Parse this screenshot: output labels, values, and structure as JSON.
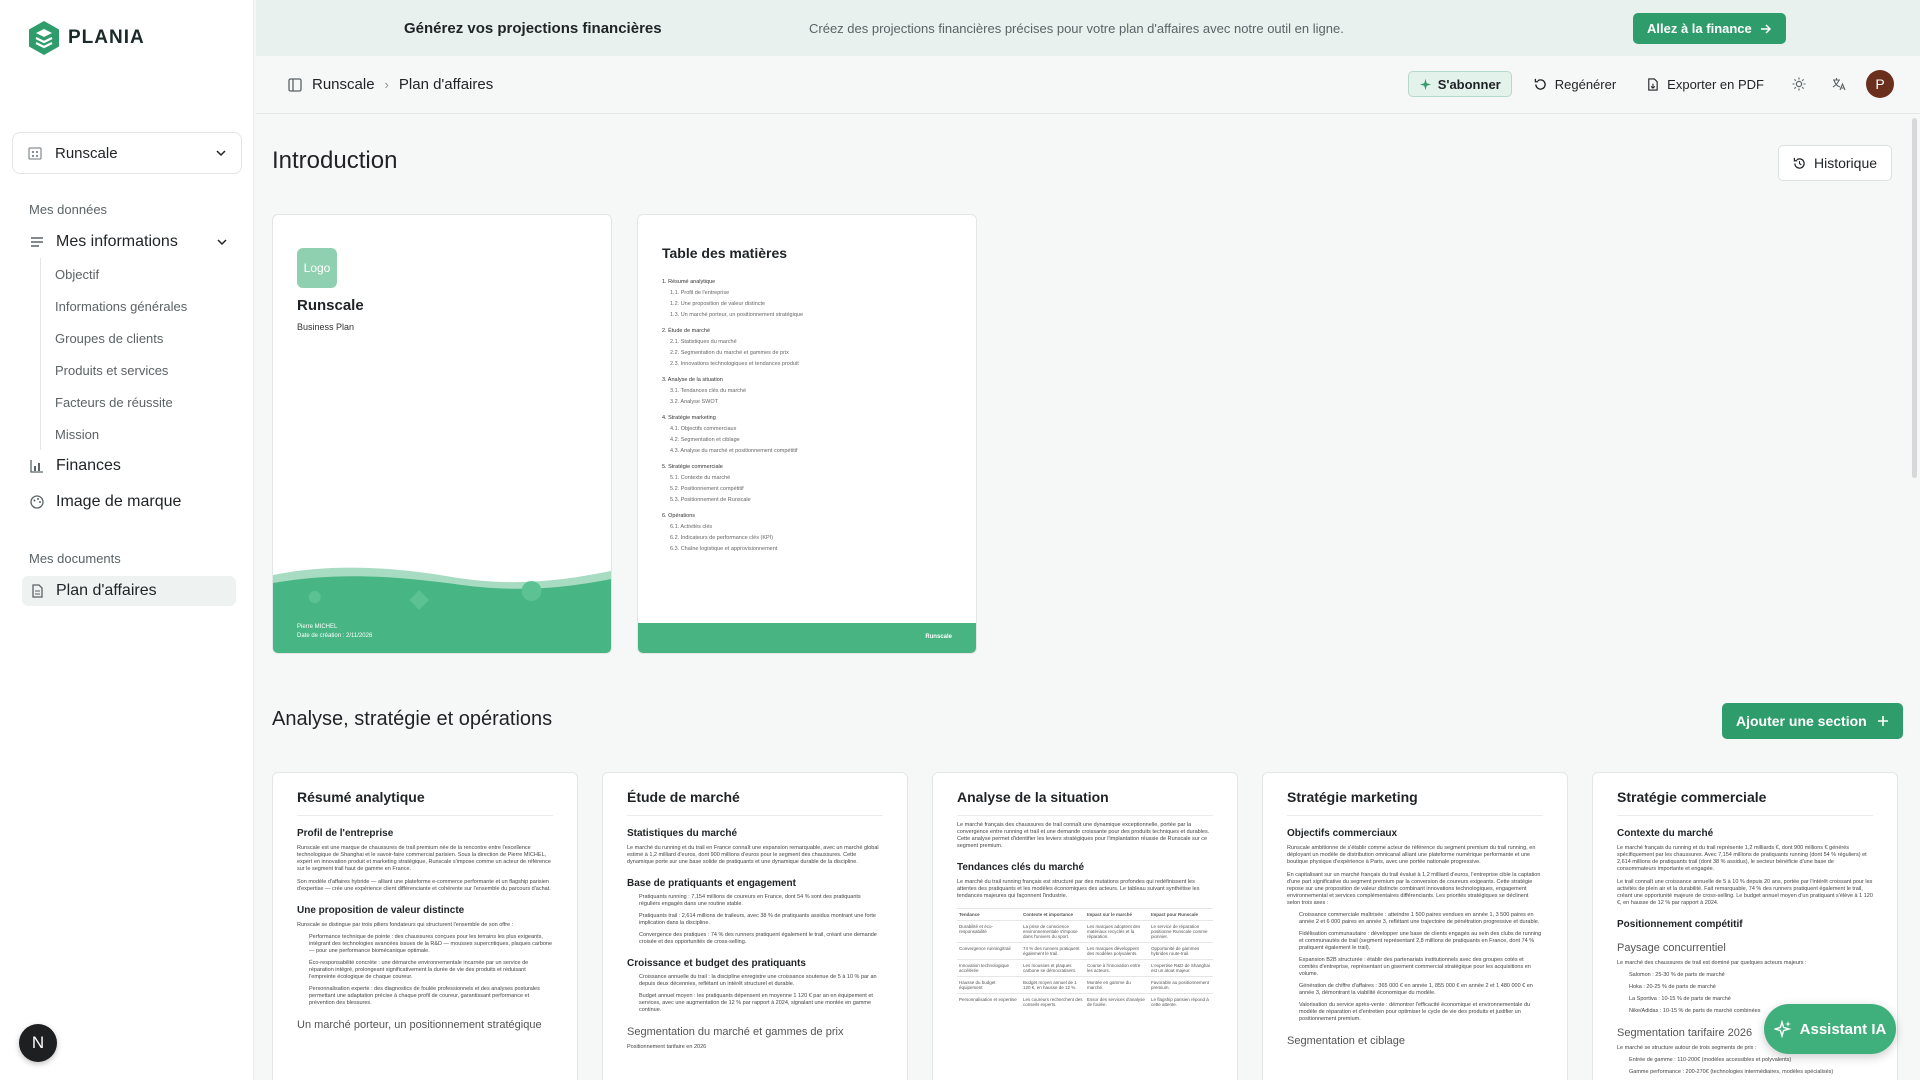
{
  "brand": {
    "name": "PLANIA",
    "accent": "#2f9c6c"
  },
  "banner": {
    "title": "Générez vos projections financières",
    "description": "Créez des projections financières précises pour votre plan d'affaires avec notre outil en ligne.",
    "cta": "Allez à la finance"
  },
  "sidebar": {
    "workspace": "Runscale",
    "section_data": "Mes données",
    "my_info": "Mes informations",
    "sub_items": [
      "Objectif",
      "Informations générales",
      "Groupes de clients",
      "Produits et services",
      "Facteurs de réussite",
      "Mission"
    ],
    "finances": "Finances",
    "brand_image": "Image de marque",
    "section_docs": "Mes documents",
    "business_plan": "Plan d'affaires",
    "bottom_avatar": "N"
  },
  "header": {
    "breadcrumb": [
      "Runscale",
      "Plan d'affaires"
    ],
    "subscribe": "S'abonner",
    "regenerate": "Regénérer",
    "export_pdf": "Exporter en PDF",
    "user_initial": "P"
  },
  "intro": {
    "title": "Introduction",
    "history": "Historique",
    "cover": {
      "logo": "Logo",
      "company": "Runscale",
      "subtitle": "Business Plan",
      "author": "Pierre MICHEL",
      "date": "Date de création : 2/11/2026"
    },
    "toc": {
      "title": "Table des matières",
      "footer": "Runscale",
      "sections": [
        {
          "title": "1. Résumé analytique",
          "items": [
            "1.1. Profil de l'entreprise",
            "1.2. Une proposition de valeur distincte",
            "1.3. Un marché porteur, un positionnement stratégique"
          ]
        },
        {
          "title": "2. Étude de marché",
          "items": [
            "2.1. Statistiques du marché",
            "2.2. Segmentation du marché et gammes de prix",
            "2.3. Innovations technologiques et tendances produit"
          ]
        },
        {
          "title": "3. Analyse de la situation",
          "items": [
            "3.1. Tendances clés du marché",
            "3.2. Analyse SWOT"
          ]
        },
        {
          "title": "4. Stratégie marketing",
          "items": [
            "4.1. Objectifs commerciaux",
            "4.2. Segmentation et ciblage",
            "4.3. Analyse du marché et positionnement compétitif"
          ]
        },
        {
          "title": "5. Stratégie commerciale",
          "items": [
            "5.1. Contexte du marché",
            "5.2. Positionnement compétitif",
            "5.3. Positionnement de Runscale"
          ]
        },
        {
          "title": "6. Opérations",
          "items": [
            "6.1. Activités clés",
            "6.2. Indicateurs de performance clés (KPI)",
            "6.3. Chaîne logistique et approvisionnement"
          ]
        }
      ]
    }
  },
  "analysis": {
    "title": "Analyse, stratégie et opérations",
    "add_section": "Ajouter une section",
    "cards": [
      {
        "title": "Résumé analytique",
        "blocks": [
          {
            "type": "sub",
            "text": "Profil de l'entreprise"
          },
          {
            "type": "text",
            "text": "Runscale est une marque de chaussures de trail premium née de la rencontre entre l'excellence technologique de Shanghai et le savoir-faire commercial parisien. Sous la direction de Pierre MICHEL, expert en innovation produit et marketing stratégique, Runscale s'impose comme un acteur de référence sur le segment trail haut de gamme en France."
          },
          {
            "type": "text",
            "text": "Son modèle d'affaires hybride — alliant une plateforme e-commerce performante et un flagship parisien d'expertise — crée une expérience client différenciante et cohérente sur l'ensemble du parcours d'achat."
          },
          {
            "type": "sub",
            "text": "Une proposition de valeur distincte"
          },
          {
            "type": "text",
            "text": "Runscale se distingue par trois piliers fondateurs qui structurent l'ensemble de son offre :"
          },
          {
            "type": "bullet",
            "text": "Performance technique de pointe : des chaussures conçues pour les terrains les plus exigeants, intégrant des technologies avancées issues de la R&D — mousses supercritiques, plaques carbone — pour une performance biomécanique optimale."
          },
          {
            "type": "bullet",
            "text": "Éco-responsabilité concrète : une démarche environnementale incarnée par un service de réparation intégré, prolongeant significativement la durée de vie des produits et réduisant l'empreinte écologique de chaque coureur."
          },
          {
            "type": "bullet",
            "text": "Personnalisation experte : des diagnostics de foulée professionnels et des analyses posturales permettant une adaptation précise à chaque profil de coureur, garantissant performance et prévention des blessures."
          },
          {
            "type": "sublight",
            "text": "Un marché porteur, un positionnement stratégique"
          }
        ]
      },
      {
        "title": "Étude de marché",
        "blocks": [
          {
            "type": "sub",
            "text": "Statistiques du marché"
          },
          {
            "type": "text",
            "text": "Le marché du running et du trail en France connaît une expansion remarquable, avec un marché global estimé à 1,2 milliard d'euros, dont 900 millions d'euros pour le segment des chaussures. Cette dynamique porte sur une base solide de pratiquants et une dynamique durable de la discipline."
          },
          {
            "type": "sub",
            "text": "Base de pratiquants et engagement"
          },
          {
            "type": "bullet",
            "text": "Pratiquants running : 7,154 millions de coureurs en France, dont 54 % sont des pratiquants réguliers engagés dans une routine stable."
          },
          {
            "type": "bullet",
            "text": "Pratiquants trail : 2,614 millions de traileurs, avec 38 % de pratiquants assidus montrant une forte implication dans la discipline."
          },
          {
            "type": "bullet",
            "text": "Convergence des pratiques : 74 % des runners pratiquent également le trail, créant une demande croisée et des opportunités de cross-selling."
          },
          {
            "type": "sub",
            "text": "Croissance et budget des pratiquants"
          },
          {
            "type": "bullet",
            "text": "Croissance annuelle du trail : la discipline enregistre une croissance soutenue de 5 à 10 % par an depuis deux décennies, reflétant un intérêt structurel et durable."
          },
          {
            "type": "bullet",
            "text": "Budget annuel moyen : les pratiquants dépensent en moyenne 1 120 € par an en équipement et services, avec une augmentation de 12 % par rapport à 2024, signalant une montée en gamme continue."
          },
          {
            "type": "sublight",
            "text": "Segmentation du marché et gammes de prix"
          },
          {
            "type": "text",
            "text": "Positionnement tarifaire en 2026"
          }
        ]
      },
      {
        "title": "Analyse de la situation",
        "blocks": [
          {
            "type": "text",
            "text": "Le marché français des chaussures de trail connaît une dynamique exceptionnelle, portée par la convergence entre running et trail et une demande croissante pour des produits techniques et durables. Cette analyse permet d'identifier les leviers stratégiques pour l'implantation réussie de Runscale sur ce segment premium."
          },
          {
            "type": "sub",
            "text": "Tendances clés du marché"
          },
          {
            "type": "text",
            "text": "Le marché du trail running français est structuré par des mutations profondes qui redéfinissent les attentes des pratiquants et les modèles économiques des acteurs. Le tableau suivant synthétise les tendances majeures qui façonnent l'industrie."
          },
          {
            "type": "table",
            "rows": [
              [
                "Tendance",
                "Contexte et importance",
                "Impact sur le marché",
                "Impact pour Runscale"
              ],
              [
                "Durabilité et éco-responsabilité",
                "La prise de conscience environnementale s'impose dans l'univers du sport.",
                "Les marques adoptent des matériaux recyclés et la réparation.",
                "Le service de réparation positionne Runscale comme pionnier."
              ],
              [
                "Convergence running/trail",
                "74 % des runners pratiquent également le trail.",
                "Les marques développent des modèles polyvalents.",
                "Opportunité de gammes hybrides route-trail."
              ],
              [
                "Innovation technologique accélérée",
                "Les mousses et plaques carbone se démocratisent.",
                "Course à l'innovation entre les acteurs.",
                "L'expertise R&D de Shanghai est un atout majeur."
              ],
              [
                "Hausse du budget équipement",
                "Budget moyen annuel de 1 120 €, en hausse de 12 %.",
                "Montée en gamme du marché.",
                "Favorable au positionnement premium."
              ],
              [
                "Personnalisation et expertise",
                "Les coureurs recherchent des conseils experts.",
                "Essor des services d'analyse de foulée.",
                "Le flagship parisien répond à cette attente."
              ]
            ]
          }
        ]
      },
      {
        "title": "Stratégie marketing",
        "blocks": [
          {
            "type": "sub",
            "text": "Objectifs commerciaux"
          },
          {
            "type": "text",
            "text": "Runscale ambitionne de s'établir comme acteur de référence du segment premium du trail running, en déployant un modèle de distribution omnicanal alliant une plateforme numérique performante et une boutique physique d'expérience à Paris, avec une portée nationale progressive."
          },
          {
            "type": "text",
            "text": "En capitalisant sur un marché français du trail évalué à 1,2 milliard d'euros, l'entreprise cible la captation d'une part significative du segment premium par la conversion de coureurs exigeants. Cette stratégie repose sur une proposition de valeur distincte combinant innovations technologiques, engagement environnemental et services complémentaires différenciants. Les priorités stratégiques se déclinent selon trois axes :"
          },
          {
            "type": "bullet",
            "text": "Croissance commerciale maîtrisée : atteindre 1 500 paires vendues en année 1, 3 500 paires en année 2 et 6 000 paires en année 3, reflétant une trajectoire de pénétration progressive et durable."
          },
          {
            "type": "bullet",
            "text": "Fidélisation communautaire : développer une base de clients engagés au sein des clubs de running et communautés de trail (segment représentant 2,8 millions de pratiquants en France, dont 74 % pratiquent également le trail)."
          },
          {
            "type": "bullet",
            "text": "Expansion B2B structurée : établir des partenariats institutionnels avec des groupes cotés et comités d'entreprise, représentant un gisement commercial stratégique pour les acquisitions en volume."
          },
          {
            "type": "bullet",
            "text": "Génération de chiffre d'affaires : 365 000 € en année 1, 855 000 € en année 2 et 1 480 000 € en année 3, démontrant la viabilité économique du modèle."
          },
          {
            "type": "bullet",
            "text": "Valorisation du service après-vente : démontrer l'efficacité économique et environnementale du modèle de réparation et d'entretien pour optimiser le cycle de vie des produits et justifier un positionnement premium."
          },
          {
            "type": "sublight",
            "text": "Segmentation et ciblage"
          }
        ]
      },
      {
        "title": "Stratégie commerciale",
        "blocks": [
          {
            "type": "sub",
            "text": "Contexte du marché"
          },
          {
            "type": "text",
            "text": "Le marché français du running et du trail représente 1,2 milliards €, dont 900 millions € générés spécifiquement par les chaussures. Avec 7,154 millions de pratiquants running (dont 54 % réguliers) et 2,614 millions de pratiquants trail (dont 38 % assidus), le secteur bénéficie d'une base de consommateurs importante et engagée."
          },
          {
            "type": "text",
            "text": "Le trail connaît une croissance annuelle de 5 à 10 % depuis 20 ans, portée par l'intérêt croissant pour les activités de plein air et la durabilité. Fait remarquable, 74 % des runners pratiquent également le trail, créant une opportunité majeure de cross-selling. Le budget annuel moyen d'un pratiquant s'élève à 1 120 €, en hausse de 12 % par rapport à 2024."
          },
          {
            "type": "sub",
            "text": "Positionnement compétitif"
          },
          {
            "type": "sublight",
            "text": "Paysage concurrentiel"
          },
          {
            "type": "text",
            "text": "Le marché des chaussures de trail est dominé par quelques acteurs majeurs :"
          },
          {
            "type": "bullet",
            "text": "Salomon : 25-30 % de parts de marché"
          },
          {
            "type": "bullet",
            "text": "Hoka : 20-25 % de parts de marché"
          },
          {
            "type": "bullet",
            "text": "La Sportiva : 10-15 % de parts de marché"
          },
          {
            "type": "bullet",
            "text": "Nike/Adidas : 10-15 % de parts de marché combinées"
          },
          {
            "type": "sublight",
            "text": "Segmentation tarifaire 2026"
          },
          {
            "type": "text",
            "text": "Le marché se structure autour de trois segments de prix :"
          },
          {
            "type": "bullet",
            "text": "Entrée de gamme : 110-200€ (modèles accessibles et polyvalents)"
          },
          {
            "type": "bullet",
            "text": "Gamme performance : 200-270€ (technologies intermédiaires, modèles spécialisés)"
          }
        ]
      }
    ]
  },
  "assistant": {
    "label": "Assistant IA"
  }
}
